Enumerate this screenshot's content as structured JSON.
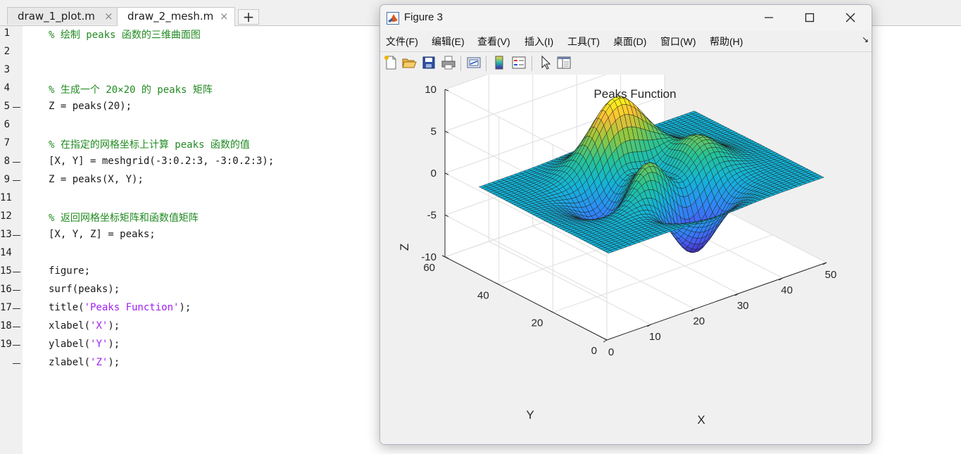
{
  "editor": {
    "tabs": [
      {
        "label": "draw_1_plot.m",
        "active": false
      },
      {
        "label": "draw_2_mesh.m",
        "active": true
      }
    ],
    "add_tab_label": "+",
    "close_glyph": "×",
    "lines": [
      {
        "num": "1",
        "exec": false
      },
      {
        "num": "2",
        "exec": false
      },
      {
        "num": "3",
        "exec": false
      },
      {
        "num": "4",
        "exec": false
      },
      {
        "num": "5",
        "exec": true
      },
      {
        "num": "6",
        "exec": false
      },
      {
        "num": "7",
        "exec": false
      },
      {
        "num": "8",
        "exec": true
      },
      {
        "num": "9",
        "exec": true
      },
      {
        "num": "11",
        "exec": false
      },
      {
        "num": "12",
        "exec": true
      },
      {
        "num": "13",
        "exec": false
      },
      {
        "num": "14",
        "exec": true
      },
      {
        "num": "15",
        "exec": true
      },
      {
        "num": "16",
        "exec": true
      },
      {
        "num": "17",
        "exec": true
      },
      {
        "num": "18",
        "exec": true
      },
      {
        "num": "19",
        "exec": true
      }
    ],
    "code": {
      "c1": "% 绘制 peaks 函数的三维曲面图",
      "c4": "% 生成一个 20×20 的 peaks 矩阵",
      "c5": "Z = peaks(20);",
      "c7": "% 在指定的网格坐标上计算 peaks 函数的值",
      "c8": "[X, Y] = meshgrid(-3:0.2:3, -3:0.2:3);",
      "c9": "Z = peaks(X, Y);",
      "c11": "% 返回网格坐标矩阵和函数值矩阵",
      "c12": "[X, Y, Z] = peaks;",
      "c14": "figure;",
      "c15": "surf(peaks);",
      "c16a": "title(",
      "c16s": "'Peaks Function'",
      "c16b": ");",
      "c17a": "xlabel(",
      "c17s": "'X'",
      "c17b": ");",
      "c18a": "ylabel(",
      "c18s": "'Y'",
      "c18b": ");",
      "c19a": "zlabel(",
      "c19s": "'Z'",
      "c19b": ");"
    }
  },
  "figure": {
    "title": "Figure 3",
    "window_buttons": {
      "minimize": "—",
      "maximize": "☐",
      "close": "✕"
    },
    "menus": [
      "文件(F)",
      "编辑(E)",
      "查看(V)",
      "插入(I)",
      "工具(T)",
      "桌面(D)",
      "窗口(W)",
      "帮助(H)"
    ],
    "menu_arrow": "↘",
    "toolbar": [
      "new-figure-icon",
      "open-file-icon",
      "save-icon",
      "print-icon",
      "link-plot-icon",
      "colorbar-icon",
      "legend-icon",
      "pointer-icon",
      "property-editor-icon"
    ]
  },
  "chart_data": {
    "type": "surface",
    "function": "peaks",
    "grid_size": 49,
    "title": "Peaks Function",
    "xlabel": "X",
    "ylabel": "Y",
    "zlabel": "Z",
    "xlim": [
      0,
      50
    ],
    "ylim": [
      0,
      60
    ],
    "zlim": [
      -10,
      10
    ],
    "xticks": [
      0,
      10,
      20,
      30,
      40,
      50
    ],
    "yticks": [
      0,
      20,
      40,
      60
    ],
    "zticks": [
      -10,
      -5,
      0,
      5,
      10
    ],
    "colormap": "parula",
    "grid": true
  }
}
